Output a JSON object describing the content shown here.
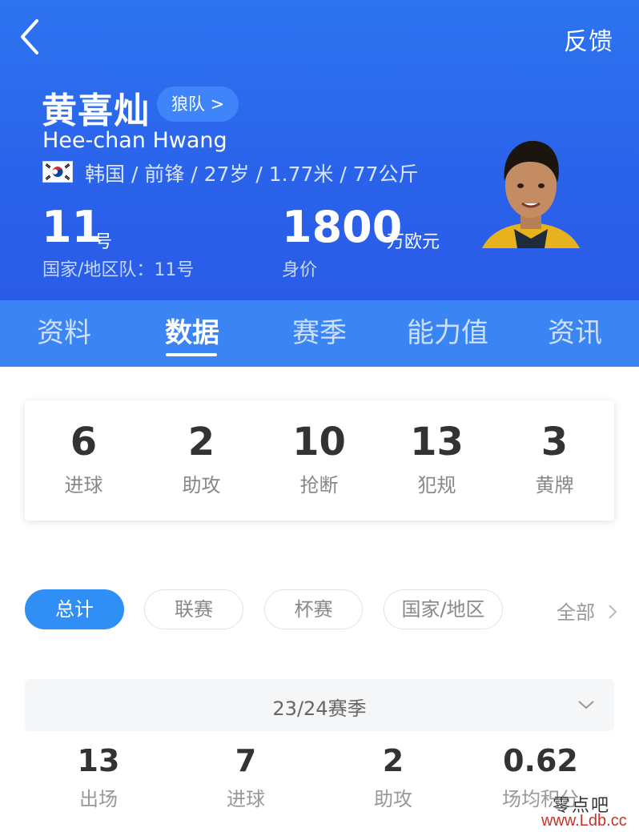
{
  "header": {
    "feedback_label": "反馈",
    "player_name_cn": "黄喜灿",
    "club_label": "狼队 >",
    "player_name_en": "Hee-chan Hwang",
    "profile_line": "韩国 / 前锋 / 27岁 / 1.77米 / 77公斤",
    "shirt_number": "11",
    "shirt_number_unit": "号",
    "shirt_number_label": "国家/地区队：11号",
    "market_value": "1800",
    "market_value_unit": "万欧元",
    "market_value_label": "身价",
    "colors": {
      "background": "#2a62ea",
      "accent": "#3a84f4"
    }
  },
  "tabs": [
    {
      "label": "资料",
      "active": false
    },
    {
      "label": "数据",
      "active": true
    },
    {
      "label": "赛季",
      "active": false
    },
    {
      "label": "能力值",
      "active": false
    },
    {
      "label": "资讯",
      "active": false
    }
  ],
  "summary": [
    {
      "value": "6",
      "label": "进球"
    },
    {
      "value": "2",
      "label": "助攻"
    },
    {
      "value": "10",
      "label": "抢断"
    },
    {
      "value": "13",
      "label": "犯规"
    },
    {
      "value": "3",
      "label": "黄牌"
    }
  ],
  "filters": {
    "pills": [
      {
        "label": "总计",
        "active": true
      },
      {
        "label": "联赛",
        "active": false
      },
      {
        "label": "杯赛",
        "active": false
      },
      {
        "label": "国家/地区",
        "active": false
      }
    ],
    "all_label": "全部",
    "active_color": "#2f8ff5"
  },
  "season": {
    "selected": "23/24赛季",
    "stats": [
      {
        "value": "13",
        "label": "出场"
      },
      {
        "value": "7",
        "label": "进球"
      },
      {
        "value": "2",
        "label": "助攻"
      },
      {
        "value": "0.62",
        "label": "场均积分"
      }
    ]
  },
  "watermark": {
    "text_cn": "零点吧",
    "url": "www.Ldb.cc"
  },
  "icons": {
    "back": "chevron-left-icon",
    "flag": "south-korea-flag-icon",
    "all_chevron": "chevron-right-icon",
    "season_chevron": "chevron-down-icon"
  }
}
